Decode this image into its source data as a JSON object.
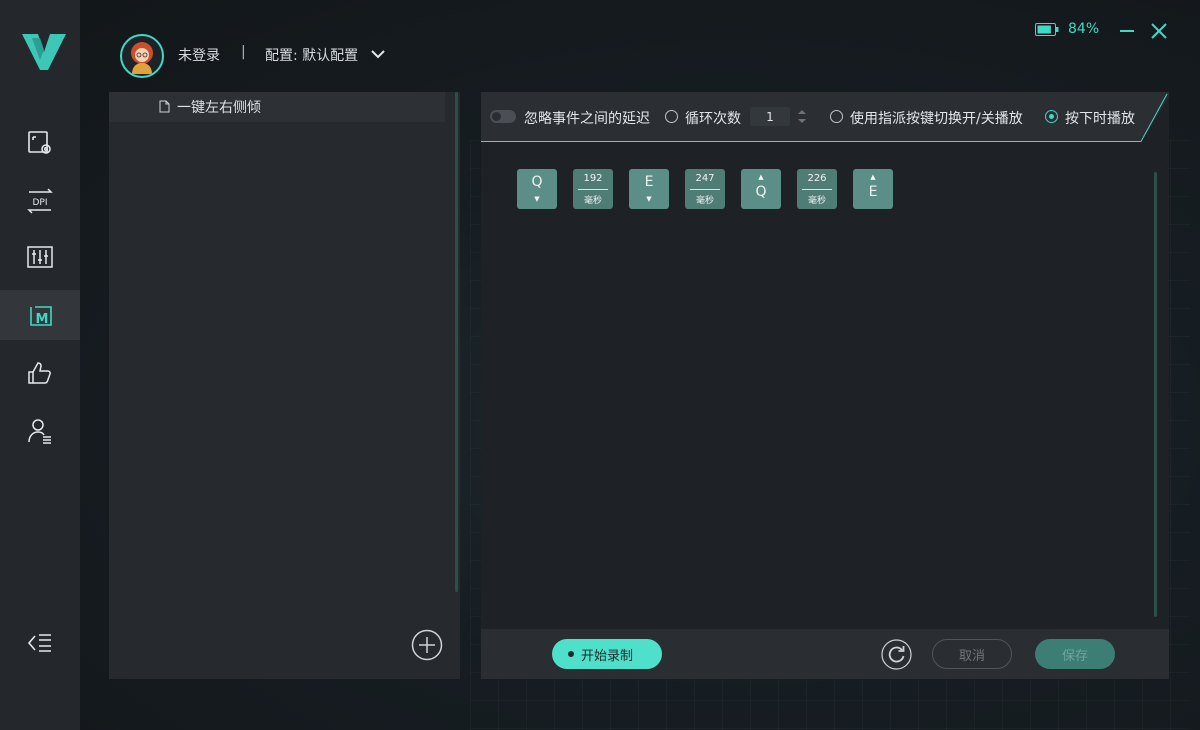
{
  "sidebar": {
    "logo": "v-logo-icon",
    "items": [
      {
        "icon": "key-settings-icon"
      },
      {
        "icon": "dpi-icon",
        "label": "DPI"
      },
      {
        "icon": "equalizer-icon"
      },
      {
        "icon": "macro-icon",
        "label": "M",
        "active": true
      },
      {
        "icon": "thumbs-up-icon"
      },
      {
        "icon": "user-profile-icon"
      }
    ],
    "collapse_icon": "collapse-menu-icon"
  },
  "header": {
    "user_status": "未登录",
    "separator": "|",
    "config_label": "配置: 默认配置"
  },
  "status": {
    "battery_percent": "84%",
    "battery_level": 0.84
  },
  "macro_list": {
    "items": [
      {
        "name": "一键左右侧倾"
      }
    ]
  },
  "toolbar": {
    "ignore_delay_label": "忽略事件之间的延迟",
    "ignore_delay_enabled": false,
    "loop_label": "循环次数",
    "loop_count": "1",
    "toggle_mode_label": "使用指派按键切换开/关播放",
    "hold_mode_label": "按下时播放",
    "selected_mode": "hold"
  },
  "events": [
    {
      "type": "key",
      "key": "Q",
      "direction": "down"
    },
    {
      "type": "delay",
      "value": "192",
      "unit": "毫秒"
    },
    {
      "type": "key",
      "key": "E",
      "direction": "down"
    },
    {
      "type": "delay",
      "value": "247",
      "unit": "毫秒"
    },
    {
      "type": "key",
      "key": "Q",
      "direction": "up"
    },
    {
      "type": "delay",
      "value": "226",
      "unit": "毫秒"
    },
    {
      "type": "key",
      "key": "E",
      "direction": "up"
    }
  ],
  "footer": {
    "record_label": "开始录制",
    "cancel_label": "取消",
    "save_label": "保存"
  },
  "colors": {
    "accent": "#3fd9c5",
    "key_block": "#5a8e86",
    "sidebar_bg": "#24272b"
  }
}
